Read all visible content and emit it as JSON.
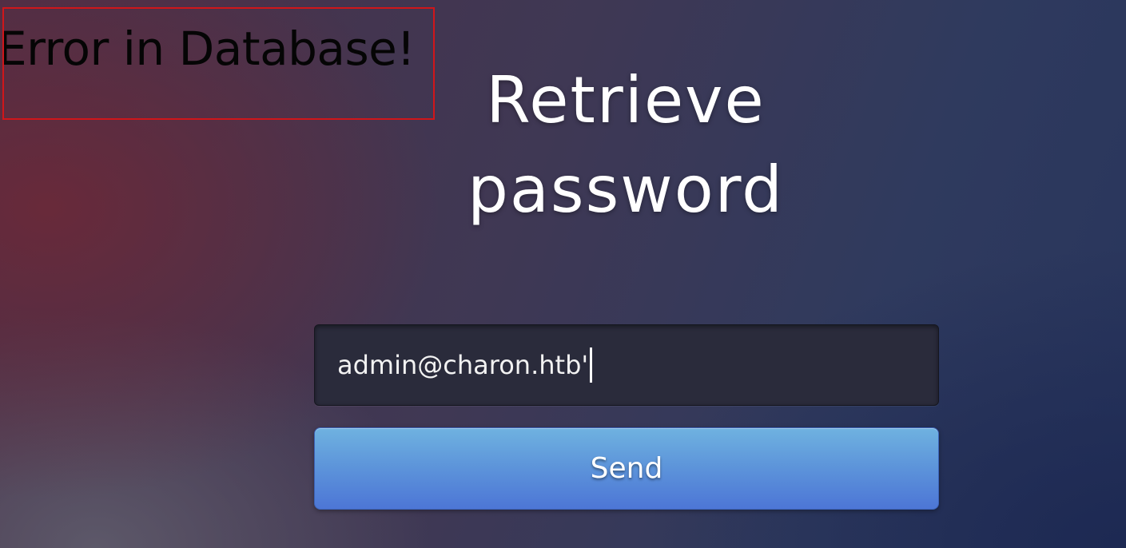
{
  "error": {
    "message": "Error in Database!",
    "border_color": "#d0161a"
  },
  "title": {
    "line1": "Retrieve",
    "line2": "password"
  },
  "form": {
    "email_value": "admin@charon.htb'",
    "send_label": "Send",
    "button_color": "#5c93da"
  }
}
